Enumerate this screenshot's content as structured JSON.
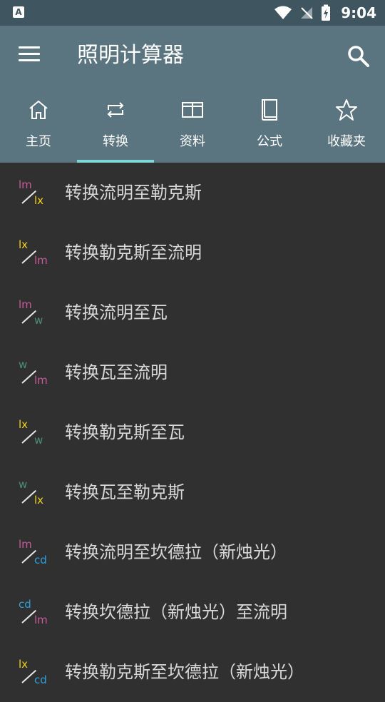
{
  "status_bar": {
    "time": "9:04",
    "left_icon": "A"
  },
  "app_bar": {
    "title": "照明计算器",
    "menu_icon": "menu-icon",
    "search_icon": "search-icon"
  },
  "tabs": [
    {
      "label": "主页",
      "icon": "home-icon",
      "active": false
    },
    {
      "label": "转换",
      "icon": "repeat-icon",
      "active": true
    },
    {
      "label": "资料",
      "icon": "table-icon",
      "active": false
    },
    {
      "label": "公式",
      "icon": "book-icon",
      "active": false
    },
    {
      "label": "收藏夹",
      "icon": "star-icon",
      "active": false
    }
  ],
  "colors": {
    "lm": "#c85a9a",
    "lx": "#f1d21d",
    "w": "#4e8f74",
    "cd": "#2f9fdc",
    "accent": "#7fd6d8"
  },
  "items": [
    {
      "from": "lm",
      "to": "lx",
      "label": "转换流明至勒克斯"
    },
    {
      "from": "lx",
      "to": "lm",
      "label": "转换勒克斯至流明"
    },
    {
      "from": "lm",
      "to": "w",
      "label": "转换流明至瓦"
    },
    {
      "from": "w",
      "to": "lm",
      "label": "转换瓦至流明"
    },
    {
      "from": "lx",
      "to": "w",
      "label": "转换勒克斯至瓦"
    },
    {
      "from": "w",
      "to": "lx",
      "label": "转换瓦至勒克斯"
    },
    {
      "from": "lm",
      "to": "cd",
      "label": "转换流明至坎德拉（新烛光）"
    },
    {
      "from": "cd",
      "to": "lm",
      "label": "转换坎德拉（新烛光）至流明"
    },
    {
      "from": "lx",
      "to": "cd",
      "label": "转换勒克斯至坎德拉（新烛光）"
    }
  ]
}
